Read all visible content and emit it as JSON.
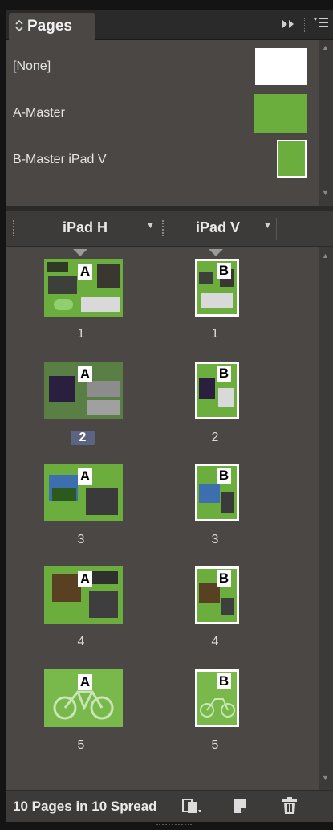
{
  "panel": {
    "tab_label": "Pages",
    "tab_arrows_icon": "collapse-expand-icon",
    "forward_icon": "double-arrow-icon",
    "menu_icon": "panel-menu-icon"
  },
  "masters": [
    {
      "name": "[None]",
      "swatch": "#ffffff",
      "shape": "wide"
    },
    {
      "name": "A-Master",
      "swatch": "#6cae3e",
      "shape": "wide"
    },
    {
      "name": "B-Master iPad V",
      "swatch": "#6cae3e",
      "shape": "tall"
    }
  ],
  "columns": [
    {
      "label": "iPad H"
    },
    {
      "label": "iPad V"
    }
  ],
  "pages": [
    {
      "number": "1",
      "h_letter": "A",
      "v_letter": "B",
      "theme": "dark"
    },
    {
      "number": "2",
      "h_letter": "A",
      "v_letter": "B",
      "theme": "night",
      "selected": true
    },
    {
      "number": "3",
      "h_letter": "A",
      "v_letter": "B",
      "theme": "photo"
    },
    {
      "number": "4",
      "h_letter": "A",
      "v_letter": "B",
      "theme": "photo2"
    },
    {
      "number": "5",
      "h_letter": "A",
      "v_letter": "B",
      "theme": "bike"
    }
  ],
  "footer": {
    "status": "10 Pages in 10 Spread",
    "edit_page_size_icon": "page-size-icon",
    "new_page_icon": "new-page-icon",
    "delete_icon": "trash-icon"
  },
  "colors": {
    "panel_bg": "#4a4744",
    "accent_green": "#6cae3e",
    "selection": "#5b6480"
  }
}
